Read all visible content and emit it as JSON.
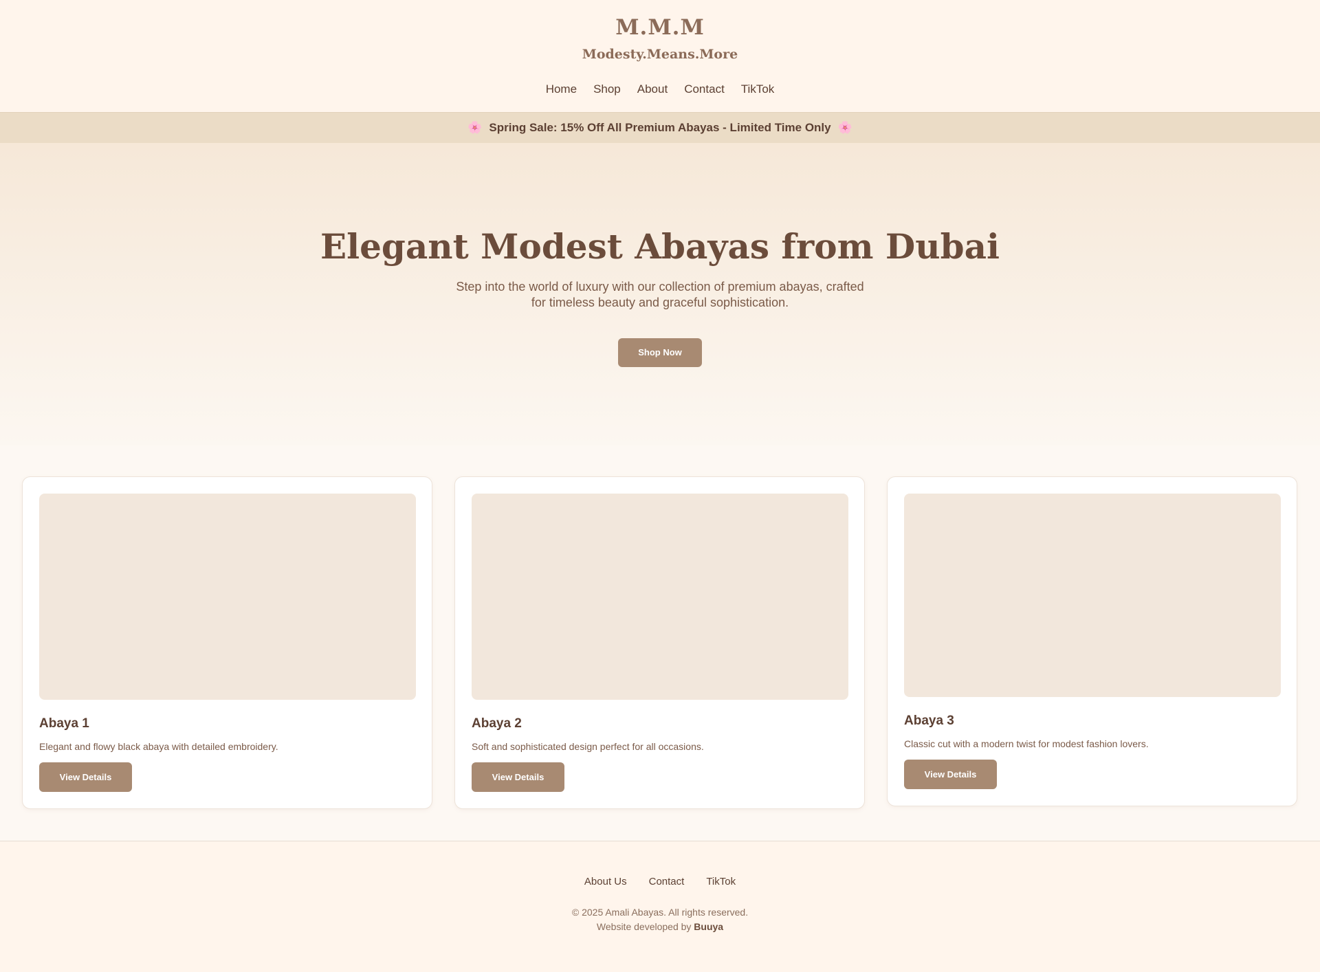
{
  "header": {
    "logo": "M.M.M",
    "tagline": "Modesty.Means.More",
    "nav": [
      {
        "label": "Home"
      },
      {
        "label": "Shop"
      },
      {
        "label": "About"
      },
      {
        "label": "Contact"
      },
      {
        "label": "TikTok"
      }
    ]
  },
  "banner": {
    "icon_left": "🌸",
    "text": "Spring Sale: 15% Off All Premium Abayas - Limited Time Only",
    "icon_right": "🌸"
  },
  "hero": {
    "title": "Elegant Modest Abayas from Dubai",
    "subtitle": "Step into the world of luxury with our collection of premium abayas, crafted for timeless beauty and graceful sophistication.",
    "cta": "Shop Now"
  },
  "products": [
    {
      "name": "Abaya 1",
      "description": "Elegant and flowy black abaya with detailed embroidery.",
      "button": "View Details"
    },
    {
      "name": "Abaya 2",
      "description": "Soft and sophisticated design perfect for all occasions.",
      "button": "View Details"
    },
    {
      "name": "Abaya 3",
      "description": "Classic cut with a modern twist for modest fashion lovers.",
      "button": "View Details"
    }
  ],
  "footer": {
    "links": [
      {
        "label": "About Us"
      },
      {
        "label": "Contact"
      },
      {
        "label": "TikTok"
      }
    ],
    "copyright": "© 2025 Amali Abayas. All rights reserved.",
    "credit_prefix": "Website developed by",
    "credit_name": "Buuya"
  },
  "colors": {
    "background": "#fff5ec",
    "banner": "#ebdcc6",
    "accent": "#a88a72",
    "text": "#5c4033",
    "image_placeholder": "#f2e7dc"
  }
}
